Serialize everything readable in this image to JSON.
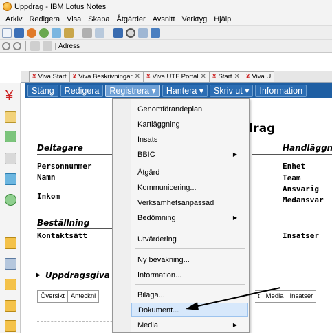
{
  "window": {
    "title": "Uppdrag - IBM Lotus Notes"
  },
  "menubar": {
    "items": [
      "Arkiv",
      "Redigera",
      "Visa",
      "Skapa",
      "Åtgärder",
      "Avsnitt",
      "Verktyg",
      "Hjälp"
    ]
  },
  "toolbar2": {
    "address_label": "Adress"
  },
  "tabs": [
    "Viva Start",
    "Viva Beskrivningar",
    "Viva UTF Portal",
    "Start",
    "Viva U"
  ],
  "actionbar": {
    "buttons": [
      "Stäng",
      "Redigera",
      "Registrera ▾",
      "Hantera ▾",
      "Skriv ut ▾",
      "Information"
    ]
  },
  "document": {
    "title": "Uppdrag",
    "deltagare": "Deltagare",
    "handlaggning": "Handläggn",
    "left_fields": [
      "Personnummer",
      "Namn",
      "Inkom"
    ],
    "right_fields": [
      "Enhet",
      "Team",
      "Ansvarig",
      "Medansvar"
    ],
    "bestallning": "Beställning",
    "kontaktsatt": "Kontaktsätt",
    "insatser": "Insatser",
    "uppdragsgivare": "Uppdragsgiva",
    "lower_tabs_left": [
      "Översikt",
      "Anteckni"
    ],
    "lower_tabs_right": [
      "t",
      "Media",
      "Insatser"
    ]
  },
  "dropdown": {
    "items": [
      {
        "label": "Genomförandeplan"
      },
      {
        "label": "Kartläggning"
      },
      {
        "label": "Insats"
      },
      {
        "label": "BBIC",
        "submenu": true
      },
      {
        "label": "Åtgärd"
      },
      {
        "label": "Kommunicering..."
      },
      {
        "label": "Verksamhetsanpassad"
      },
      {
        "label": "Bedömning",
        "submenu": true
      },
      {
        "label": "Utvärdering"
      },
      {
        "label": "Ny bevakning..."
      },
      {
        "label": "Information..."
      },
      {
        "label": "Bilaga..."
      },
      {
        "label": "Dokument...",
        "highlighted": true
      },
      {
        "label": "Media",
        "submenu": true
      }
    ]
  },
  "colors": {
    "actionbar": "#1f5fa3",
    "highlight": "#d7e8fb",
    "accent": "#cc2222"
  }
}
